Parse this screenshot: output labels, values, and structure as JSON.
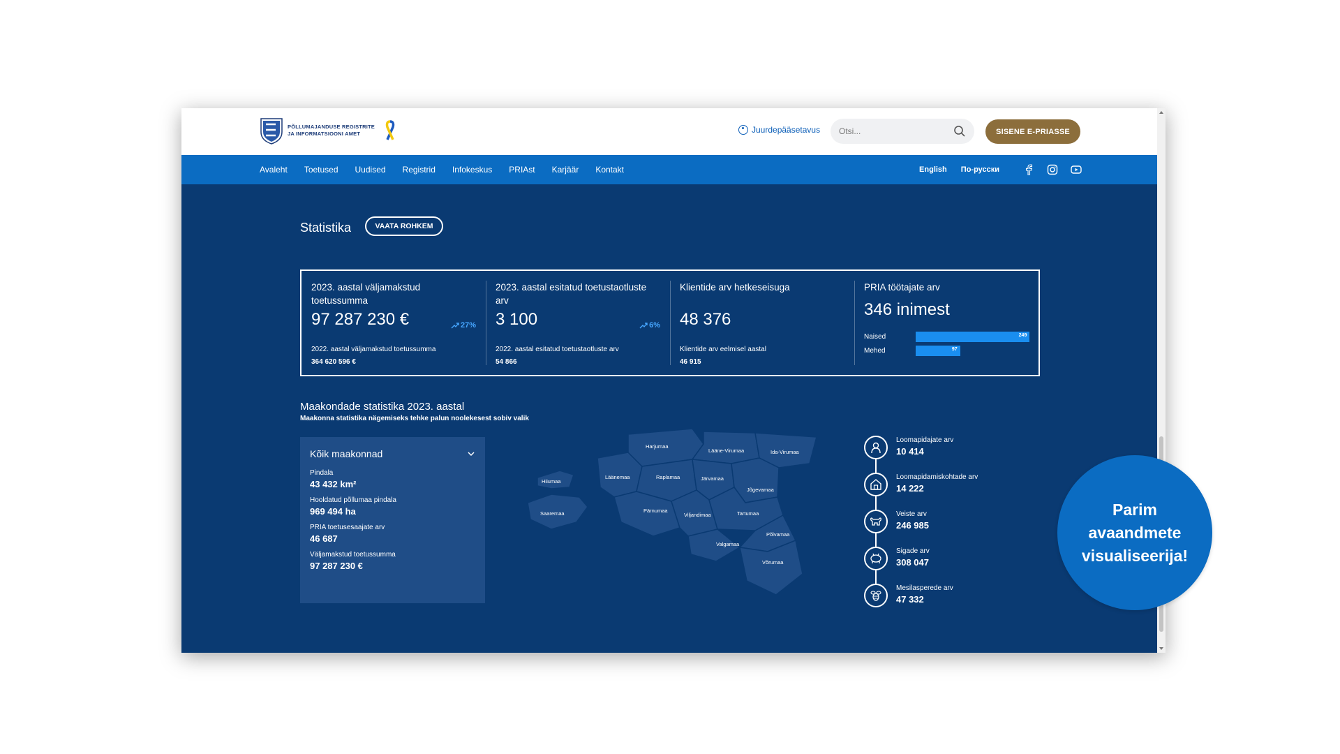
{
  "header": {
    "logo_line1": "Põllumajanduse Registrite",
    "logo_line2": "ja Informatsiooni Amet",
    "accessibility_label": "Juurdepääsetavus",
    "search_placeholder": "Otsi...",
    "cta_label": "SISENE E-PRIASSE"
  },
  "nav": {
    "items": [
      "Avaleht",
      "Toetused",
      "Uudised",
      "Registrid",
      "Infokeskus",
      "PRIAst",
      "Karjäär",
      "Kontakt"
    ],
    "lang_en": "English",
    "lang_ru": "По-русски",
    "social_icons": [
      "facebook-icon",
      "instagram-icon",
      "youtube-icon"
    ]
  },
  "stats_section": {
    "title": "Statistika",
    "more_label": "VAATA ROHKEM",
    "cards": [
      {
        "label": "2023. aastal väljamakstud toetussumma",
        "value": "97 287 230 €",
        "trend": "27%",
        "sub_label": "2022. aastal väljamakstud toetussumma",
        "sub_value": "364 620 596 €"
      },
      {
        "label": "2023. aastal esitatud toetustaotluste arv",
        "value": "3 100",
        "trend": "6%",
        "sub_label": "2022. aastal esitatud toetustaotluste arv",
        "sub_value": "54 866"
      },
      {
        "label": "Klientide arv hetkeseisuga",
        "value": "48 376",
        "sub_label": "Klientide arv eelmisel aastal",
        "sub_value": "46 915"
      },
      {
        "label": "PRIA töötajate arv",
        "value": "346 inimest"
      }
    ],
    "staff_bars": [
      {
        "name": "Naised",
        "value": 249,
        "display": "249"
      },
      {
        "name": "Mehed",
        "value": 97,
        "display": "97"
      }
    ]
  },
  "county_section": {
    "title": "Maakondade statistika 2023. aastal",
    "subtitle": "Maakonna statistika nägemiseks tehke palun noolekesest sobiv valik",
    "selected_county": "Kõik maakonnad",
    "fields": [
      {
        "label": "Pindala",
        "value": "43 432 km²"
      },
      {
        "label": "Hooldatud põllumaa pindala",
        "value": "969 494 ha"
      },
      {
        "label": "PRIA toetusesaajate arv",
        "value": "46 687"
      },
      {
        "label": "Väljamakstud toetussumma",
        "value": "97 287 230 €"
      }
    ],
    "map_labels": [
      "Harjumaa",
      "Lääne-Virumaa",
      "Ida-Virumaa",
      "Hiiumaa",
      "Läänemaa",
      "Raplamaa",
      "Järvamaa",
      "Jõgevamaa",
      "Saaremaa",
      "Pärnumaa",
      "Viljandimaa",
      "Tartumaa",
      "Põlvamaa",
      "Valgamaa",
      "Võrumaa"
    ],
    "animals": [
      {
        "label": "Loomapidajate arv",
        "value": "10 414",
        "icon": "farmer-icon"
      },
      {
        "label": "Loomapidamiskohtade arv",
        "value": "14 222",
        "icon": "barn-icon"
      },
      {
        "label": "Veiste arv",
        "value": "246 985",
        "icon": "cow-icon"
      },
      {
        "label": "Sigade arv",
        "value": "308 047",
        "icon": "pig-icon"
      },
      {
        "label": "Mesilasperede arv",
        "value": "47 332",
        "icon": "bee-icon"
      }
    ]
  },
  "badge": {
    "text": "Parim avaandmete visualiseerija!"
  },
  "colors": {
    "nav_blue": "#0b6cc2",
    "main_navy": "#0a3a72",
    "panel_blue": "#1f4d87",
    "cta_gold": "#8c6e3c",
    "trend_blue": "#46a6ff",
    "bar_blue": "#1a8ef0"
  }
}
